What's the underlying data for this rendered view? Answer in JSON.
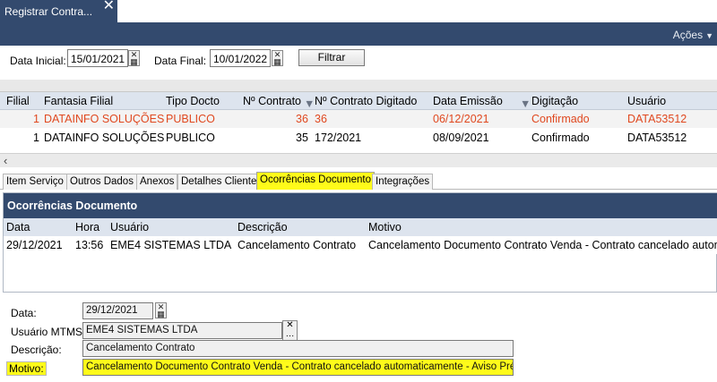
{
  "window": {
    "tab_title": "Registrar Contra...",
    "close_glyph": "✕"
  },
  "header": {
    "actions_label": "Ações",
    "actions_caret": "▼"
  },
  "filter": {
    "data_inicial_label": "Data Inicial:",
    "data_inicial_value": "15/01/2021",
    "data_final_label": "Data Final:",
    "data_final_value": "10/01/2022",
    "filtrar_label": "Filtrar"
  },
  "contracts_grid": {
    "columns": [
      "Filial",
      "Fantasia Filial",
      "Tipo Docto",
      "Nº Contrato",
      "Nº Contrato Digitado",
      "Data Emissão",
      "Digitação",
      "Usuário"
    ],
    "rows": [
      {
        "filial": "1",
        "fantasia": "DATAINFO SOLUÇÕES",
        "tipo": "PUBLICO",
        "contrato": "36",
        "digitado": "36",
        "emissao": "06/12/2021",
        "digitacao": "Confirmado",
        "usuario": "DATA53512"
      },
      {
        "filial": "1",
        "fantasia": "DATAINFO SOLUÇÕES",
        "tipo": "PUBLICO",
        "contrato": "35",
        "digitado": "172/2021",
        "emissao": "08/09/2021",
        "digitacao": "Confirmado",
        "usuario": "DATA53512"
      }
    ],
    "selected_color": "#e0481f"
  },
  "detail_tabs": [
    "Item Serviço",
    "Outros Dados",
    "Anexos",
    "Detalhes Cliente",
    "Ocorrências Documento",
    "Integrações"
  ],
  "ocorrencias": {
    "title": "Ocorrências Documento",
    "columns": [
      "Data",
      "Hora",
      "Usuário",
      "Descrição",
      "Motivo"
    ],
    "rows": [
      {
        "data": "29/12/2021",
        "hora": "13:56",
        "usuario": "EME4 SISTEMAS LTDA",
        "descricao": "Cancelamento Contrato",
        "motivo": "Cancelamento Documento Contrato Venda - Contrato cancelado autom"
      }
    ]
  },
  "form": {
    "data_label": "Data:",
    "data_value": "29/12/2021",
    "usuario_label": "Usuário MTMS:",
    "usuario_value": "EME4 SISTEMAS LTDA",
    "descricao_label": "Descrição:",
    "descricao_value": "Cancelamento Contrato",
    "motivo_label": "Motivo:",
    "motivo_value": "Cancelamento Documento Contrato Venda - Contrato cancelado automaticamente - Aviso Prévio"
  },
  "colors": {
    "header_blue": "#334a6e",
    "highlight_yellow": "#fffb1a",
    "grid_header": "#dde4ee"
  },
  "icons": [
    "close-icon",
    "chevron-down-icon",
    "calendar-icon",
    "sort-desc-icon",
    "scroll-left-icon",
    "ellipsis-icon"
  ]
}
